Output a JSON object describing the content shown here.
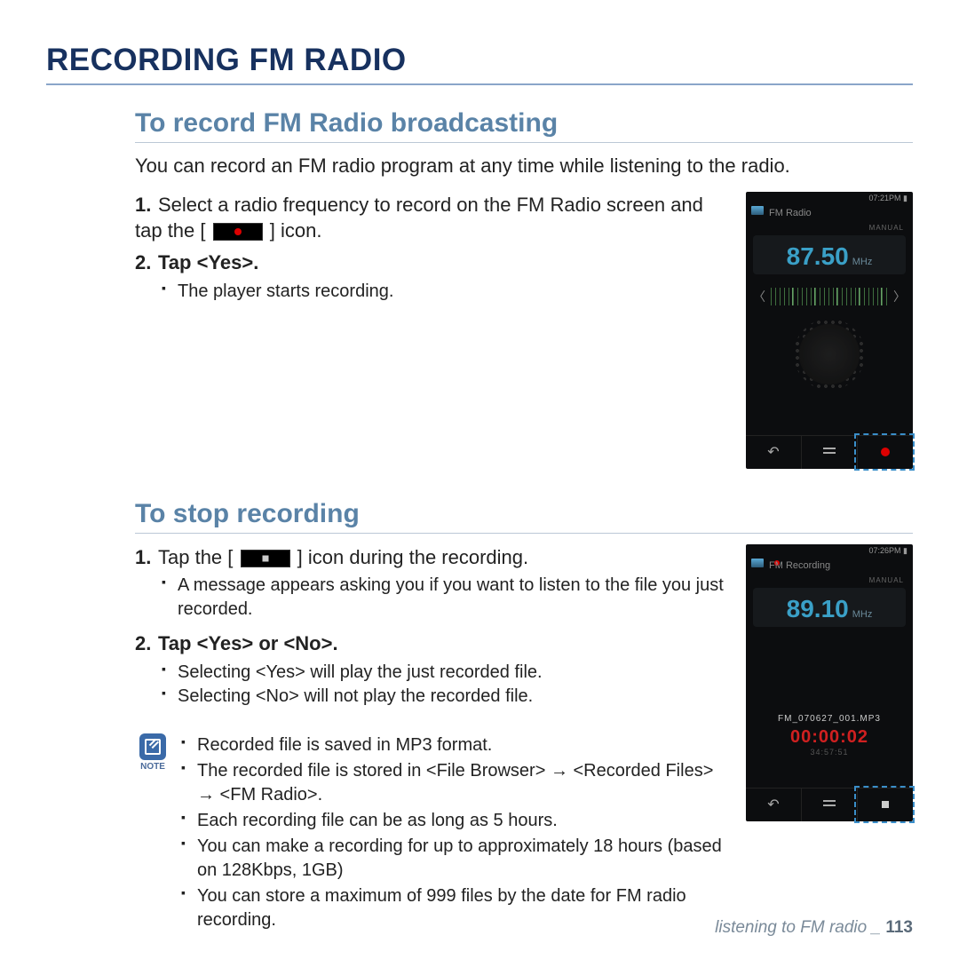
{
  "page_title": "RECORDING FM RADIO",
  "section1": {
    "title": "To record FM Radio broadcasting",
    "intro": "You can record an FM radio program at any time while listening to the radio.",
    "step1_pre": "Select a radio frequency to record on the FM Radio screen and tap the [",
    "step1_post": "] icon.",
    "step2": "Tap <Yes>.",
    "sub1": "The player starts recording."
  },
  "device1": {
    "status_time": "07:21PM",
    "app_title": "FM Radio",
    "mode": "MANUAL",
    "freq": "87.50",
    "unit": "MHz"
  },
  "section2": {
    "title": "To stop recording",
    "step1_pre": "Tap the [",
    "step1_post": "] icon during the recording.",
    "sub1": "A message appears asking you if you want to listen to the file you just recorded.",
    "step2": "Tap <Yes> or <No>.",
    "sub2a": "Selecting <Yes> will play the just recorded file.",
    "sub2b": "Selecting <No> will not play the recorded file."
  },
  "device2": {
    "status_time": "07:26PM",
    "app_title": "FM Recording",
    "mode": "MANUAL",
    "freq": "89.10",
    "unit": "MHz",
    "filename": "FM_070627_001.MP3",
    "rec_time": "00:00:02",
    "rec_remain": "34:57:51"
  },
  "note_label": "NOTE",
  "notes": {
    "n1": "Recorded file is saved in MP3 format.",
    "n2": "The recorded file is stored in <File Browser> → <Recorded Files> → <FM Radio>.",
    "n3": "Each recording file can be as long as 5 hours.",
    "n4": "You can make a recording for up to approximately 18 hours (based on 128Kbps, 1GB)",
    "n5": "You can store a maximum of 999 files by the date for FM radio recording."
  },
  "footer_text": "listening to FM radio _ ",
  "page_number": "113"
}
